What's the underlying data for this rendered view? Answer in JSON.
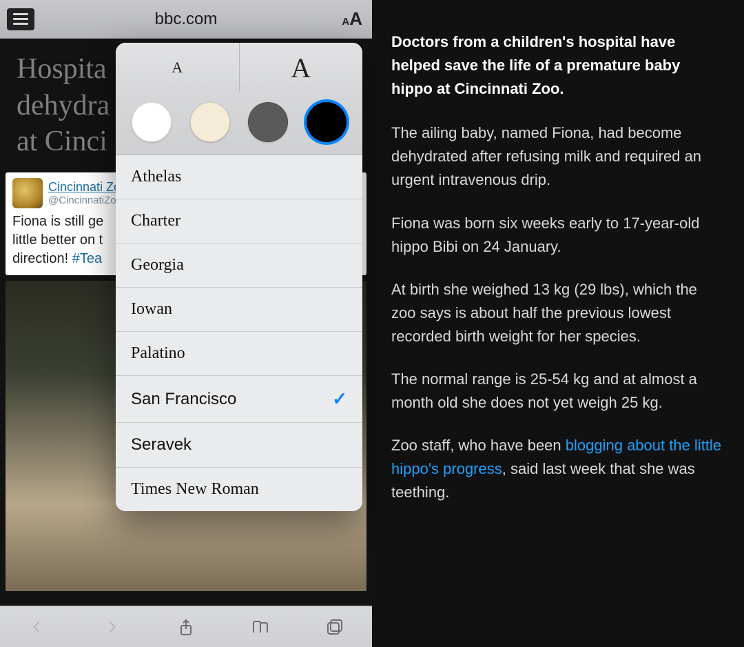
{
  "addrbar": {
    "domain": "bbc.com"
  },
  "article": {
    "headline_visible": "Hospita\ndehydrá\nat Cinci",
    "tweet": {
      "author": "Cincinnati Zoo",
      "handle": "@CincinnatiZoo",
      "body_prefix": "Fiona is still ge",
      "body_line2": "little better on t",
      "body_line3_prefix": "direction! ",
      "hashtag": "#Tea"
    }
  },
  "popover": {
    "size_small": "A",
    "size_large": "A",
    "themes": [
      "white",
      "sepia",
      "gray",
      "black"
    ],
    "selected_theme": "black",
    "fonts": [
      {
        "label": "Athelas",
        "class": "ff-athelas",
        "selected": false
      },
      {
        "label": "Charter",
        "class": "ff-charter",
        "selected": false
      },
      {
        "label": "Georgia",
        "class": "ff-georgia",
        "selected": false
      },
      {
        "label": "Iowan",
        "class": "ff-iowan",
        "selected": false
      },
      {
        "label": "Palatino",
        "class": "ff-palatino",
        "selected": false
      },
      {
        "label": "San Francisco",
        "class": "ff-sf",
        "selected": true
      },
      {
        "label": "Seravek",
        "class": "ff-seravek",
        "selected": false
      },
      {
        "label": "Times New Roman",
        "class": "ff-tnr",
        "selected": false
      }
    ]
  },
  "reader": {
    "lead": "Doctors from a children's hospital have helped save the life of a premature baby hippo at Cincinnati Zoo.",
    "p1": "The ailing baby, named Fiona, had become dehydrated after refusing milk and required an urgent intravenous drip.",
    "p2": "Fiona was born six weeks early to 17-year-old hippo Bibi on 24 January.",
    "p3": "At birth she weighed 13 kg (29 lbs), which the zoo says is about half the previous lowest recorded birth weight for her species.",
    "p4": "The normal range is 25-54 kg and at almost a month old she does not yet weigh 25 kg.",
    "p5_prefix": "Zoo staff, who have been ",
    "p5_link": "blogging about the little hippo's progress",
    "p5_suffix": ", said last week that she was teething."
  }
}
